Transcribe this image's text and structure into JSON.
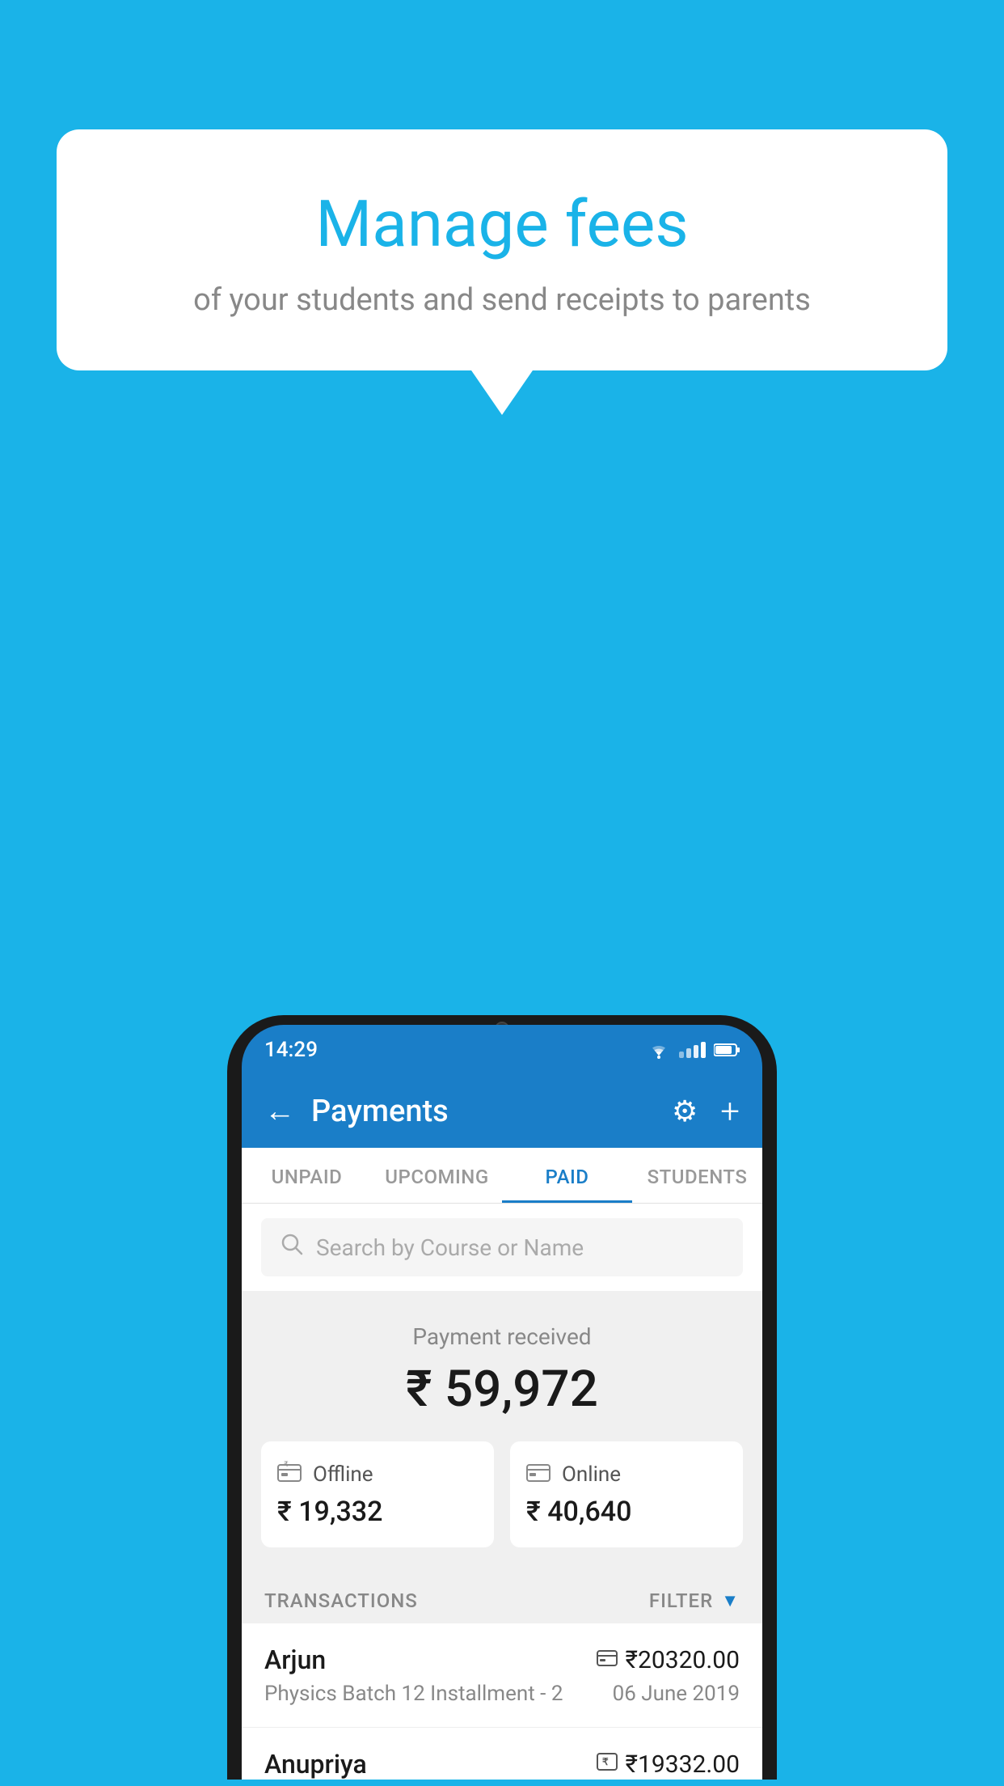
{
  "background_color": "#1ab3e8",
  "bubble": {
    "title": "Manage fees",
    "subtitle": "of your students and send receipts to parents"
  },
  "status_bar": {
    "time": "14:29",
    "wifi": "▼",
    "battery": "▐"
  },
  "header": {
    "title": "Payments",
    "back_label": "←",
    "settings_label": "⚙",
    "add_label": "+"
  },
  "tabs": [
    {
      "label": "UNPAID",
      "active": false
    },
    {
      "label": "UPCOMING",
      "active": false
    },
    {
      "label": "PAID",
      "active": true
    },
    {
      "label": "STUDENTS",
      "active": false
    }
  ],
  "search": {
    "placeholder": "Search by Course or Name"
  },
  "payment_summary": {
    "label": "Payment received",
    "amount": "₹ 59,972",
    "offline": {
      "type": "Offline",
      "amount": "₹ 19,332"
    },
    "online": {
      "type": "Online",
      "amount": "₹ 40,640"
    }
  },
  "transactions": {
    "label": "TRANSACTIONS",
    "filter_label": "FILTER",
    "rows": [
      {
        "name": "Arjun",
        "course": "Physics Batch 12 Installment - 2",
        "amount": "₹20320.00",
        "date": "06 June 2019",
        "method": "card"
      },
      {
        "name": "Anupriya",
        "course": "",
        "amount": "₹19332.00",
        "date": "",
        "method": "cash"
      }
    ]
  }
}
